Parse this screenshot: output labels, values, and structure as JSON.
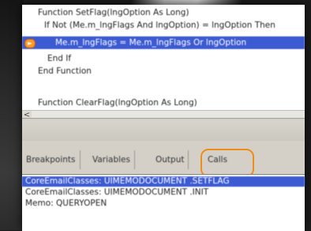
{
  "code": {
    "lines": [
      "Function SetFlag(lngOption As Long)",
      "If Not (Me.m_lngFlags And lngOption) = lngOption Then",
      "Me.m_lngFlags = Me.m_lngFlags Or lngOption",
      "End If",
      "End Function",
      "",
      "Function ClearFlag(lngOption As Long)"
    ],
    "current_line_index": 2
  },
  "tabs": [
    "Breakpoints",
    "Variables",
    "Output",
    "Calls"
  ],
  "calls": [
    "CoreEmailClasses: UIMEMODOCUMENT .SETFLAG",
    "CoreEmailClasses: UIMEMODOCUMENT .INIT",
    "Memo: QUERYOPEN"
  ],
  "colors": {
    "selection": "#3c5ad2",
    "highlight_ring": "#f08c1a"
  },
  "icons": {
    "exec_arrow": "current-line-arrow-icon",
    "scroll_left": "scroll-left-arrow-icon"
  },
  "scroll": {
    "left_arrow_glyph": "<"
  }
}
